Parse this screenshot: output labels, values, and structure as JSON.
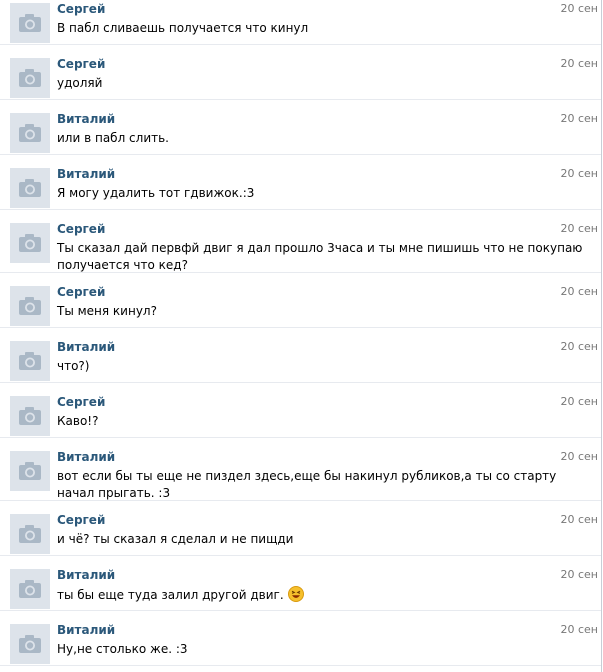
{
  "messages": [
    {
      "author": "Сергей",
      "date": "20 сен",
      "text": "В пабл сливаешь получается что кинул"
    },
    {
      "author": "Сергей",
      "date": "20 сен",
      "text": "удоляй"
    },
    {
      "author": "Виталий",
      "date": "20 сен",
      "text": "или в пабл слить."
    },
    {
      "author": "Виталий",
      "date": "20 сен",
      "text": "Я могу удалить тот гдвижок.:3"
    },
    {
      "author": "Сергей",
      "date": "20 сен",
      "text": "Ты сказал дай первфй двиг я дал прошло 3часа и ты мне пишишь что не покупаю получается что кед?"
    },
    {
      "author": "Сергей",
      "date": "20 сен",
      "text": "Ты меня кинул?"
    },
    {
      "author": "Виталий",
      "date": "20 сен",
      "text": "что?)"
    },
    {
      "author": "Сергей",
      "date": "20 сен",
      "text": "Каво!?"
    },
    {
      "author": "Виталий",
      "date": "20 сен",
      "text": "вот если бы ты еще не пиздел здесь,еще бы накинул рубликов,а ты со старту начал прыгать. :3"
    },
    {
      "author": "Сергей",
      "date": "20 сен",
      "text": "и чё? ты сказал я сделал и не пищди"
    },
    {
      "author": "Виталий",
      "date": "20 сен",
      "text": "ты бы еще туда залил другой двиг.",
      "emoji": "laughing-smiley-icon"
    },
    {
      "author": "Виталий",
      "date": "20 сен",
      "text": "Ну,не столько же. :3"
    }
  ],
  "colors": {
    "author": "#2b587a",
    "date": "#777777",
    "avatar_bg": "#dde3ea",
    "avatar_icon": "#aab8c6",
    "divider": "#e7eaef"
  }
}
